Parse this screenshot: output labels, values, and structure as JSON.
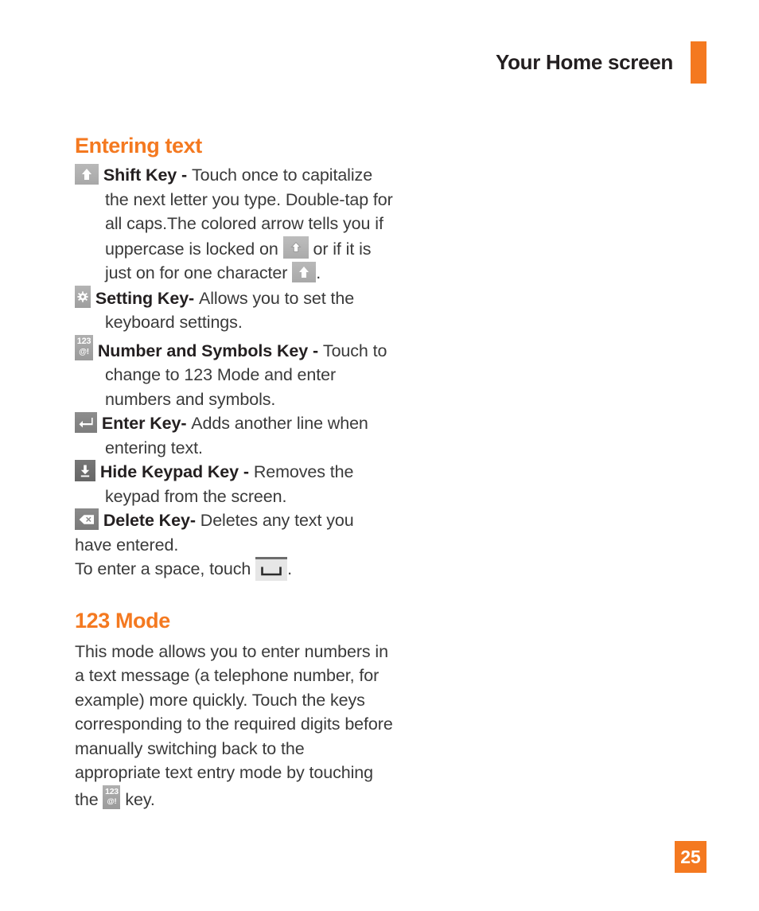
{
  "header": {
    "title": "Your Home screen",
    "accent_color": "#F47920"
  },
  "sections": [
    {
      "heading": "Entering text",
      "entries": [
        {
          "icon": "shift-key-icon",
          "term": "Shift Key - ",
          "text_part_1": "Touch once to capitalize the next letter you type. Double-tap for all caps.The colored arrow tells you if uppercase is locked on ",
          "inline_icon_1": "shift-lock-key-icon",
          "text_part_2": " or if it is just on for one character ",
          "inline_icon_2": "shift-key-icon",
          "text_part_3": "."
        },
        {
          "icon": "setting-key-icon",
          "term": "Setting Key- ",
          "text": "Allows you to set the keyboard settings."
        },
        {
          "icon": "number-symbols-key-icon",
          "term": "Number and Symbols Key - ",
          "text": "Touch to change to 123 Mode and enter numbers and symbols."
        },
        {
          "icon": "enter-key-icon",
          "term": "Enter Key- ",
          "text": "Adds another line when entering text."
        },
        {
          "icon": "hide-keypad-key-icon",
          "term": "Hide Keypad Key - ",
          "text": "Removes the keypad from the screen."
        },
        {
          "icon": "delete-key-icon",
          "term": "Delete Key- ",
          "text": "Deletes any text you have entered."
        }
      ],
      "space_line": {
        "text_before": "To enter a space, touch ",
        "icon": "space-bar-key-icon",
        "text_after": "."
      }
    },
    {
      "heading": "123 Mode",
      "paragraph": {
        "text_before": "This mode allows you to enter numbers in a text message (a telephone number, for example) more quickly. Touch the keys corresponding to the required digits before manually switching back to the appropriate text entry mode by touching the ",
        "icon": "number-symbols-key-icon",
        "text_after": " key."
      }
    }
  ],
  "key_icons": {
    "number_symbols": {
      "line1": "123",
      "line2": "@!"
    }
  },
  "footer": {
    "page_number": "25"
  }
}
